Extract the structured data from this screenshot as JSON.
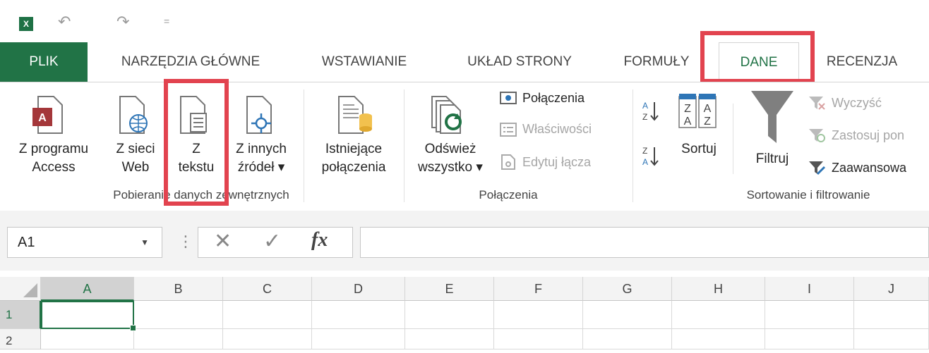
{
  "qat": {
    "app_icon": "excel-icon",
    "app_icon_text": "X",
    "undo_glyph": "↶",
    "redo_glyph": "↷",
    "more_glyph": "="
  },
  "tabs": [
    {
      "label": "PLIK"
    },
    {
      "label": "NARZĘDZIA GŁÓWNE"
    },
    {
      "label": "WSTAWIANIE"
    },
    {
      "label": "UKŁAD STRONY"
    },
    {
      "label": "FORMUŁY"
    },
    {
      "label": "DANE"
    },
    {
      "label": "RECENZJA"
    }
  ],
  "ribbon": {
    "ext_group": {
      "label": "Pobieranie danych zewnętrznych",
      "access": {
        "line1": "Z programu",
        "line2": "Access"
      },
      "web": {
        "line1": "Z sieci",
        "line2": "Web"
      },
      "text": {
        "line1": "Z",
        "line2": "tekstu"
      },
      "other": {
        "line1": "Z innych",
        "line2": "źródeł ▾"
      }
    },
    "existing": {
      "line1": "Istniejące",
      "line2": "połączenia"
    },
    "conn_group": {
      "label": "Połączenia",
      "refresh": {
        "line1": "Odśwież",
        "line2": "wszystko ▾"
      },
      "connections": "Połączenia",
      "properties": "Właściwości",
      "edit_links": "Edytuj łącza"
    },
    "sort_group": {
      "label": "Sortowanie i filtrowanie",
      "sort": "Sortuj",
      "filter": "Filtruj",
      "clear": "Wyczyść",
      "reapply": "Zastosuj pon",
      "advanced": "Zaawansowa"
    }
  },
  "formula_bar": {
    "name_box": "A1",
    "fx": "fx",
    "cancel": "✕",
    "enter": "✓",
    "dots": "⋮",
    "value": ""
  },
  "grid": {
    "columns": [
      "A",
      "B",
      "C",
      "D",
      "E",
      "F",
      "G",
      "H",
      "I",
      "J"
    ],
    "rows": [
      "1",
      "2"
    ]
  },
  "colors": {
    "accent": "#217346",
    "highlight": "#e2434f"
  }
}
